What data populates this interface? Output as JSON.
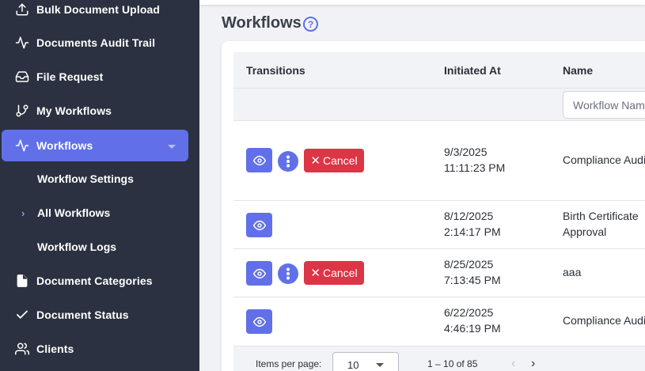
{
  "sidebar": {
    "items": [
      {
        "label": "Bulk Document Upload",
        "icon": "upload-icon"
      },
      {
        "label": "Documents Audit Trail",
        "icon": "activity-icon"
      },
      {
        "label": "File Request",
        "icon": "inbox-icon"
      },
      {
        "label": "My Workflows",
        "icon": "git-branch-icon"
      },
      {
        "label": "Workflows",
        "icon": "activity-icon",
        "active": true
      },
      {
        "label": "Document Categories",
        "icon": "file-icon"
      },
      {
        "label": "Document Status",
        "icon": "check-icon"
      },
      {
        "label": "Clients",
        "icon": "users-icon"
      }
    ],
    "subitems": [
      {
        "label": "Workflow Settings"
      },
      {
        "label": "All Workflows",
        "current": true
      },
      {
        "label": "Workflow Logs"
      }
    ],
    "accent_color": "#6170e8",
    "background_color": "#2b3140"
  },
  "page": {
    "title": "Workflows",
    "help_icon": "question-circle-icon"
  },
  "table": {
    "columns": [
      "Transitions",
      "Initiated At",
      "Name"
    ],
    "name_filter_placeholder": "Workflow Name",
    "rows": [
      {
        "date": "9/3/2025",
        "time": "11:11:23 PM",
        "name_line1": "Compliance Audit",
        "name_line2": "",
        "has_actions": true
      },
      {
        "date": "8/12/2025",
        "time": "2:14:17 PM",
        "name_line1": "Birth Certificate",
        "name_line2": "Approval",
        "has_actions": false
      },
      {
        "date": "8/25/2025",
        "time": "7:13:45 PM",
        "name_line1": "aaa",
        "name_line2": "",
        "has_actions": true
      },
      {
        "date": "6/22/2025",
        "time": "4:46:19 PM",
        "name_line1": "Compliance Audit",
        "name_line2": "",
        "has_actions": false
      }
    ],
    "cancel_label": "Cancel",
    "cancel_color": "#dc3545"
  },
  "paginator": {
    "items_per_page_label": "Items per page:",
    "page_size": "10",
    "range_label": "1 – 10 of 85"
  }
}
